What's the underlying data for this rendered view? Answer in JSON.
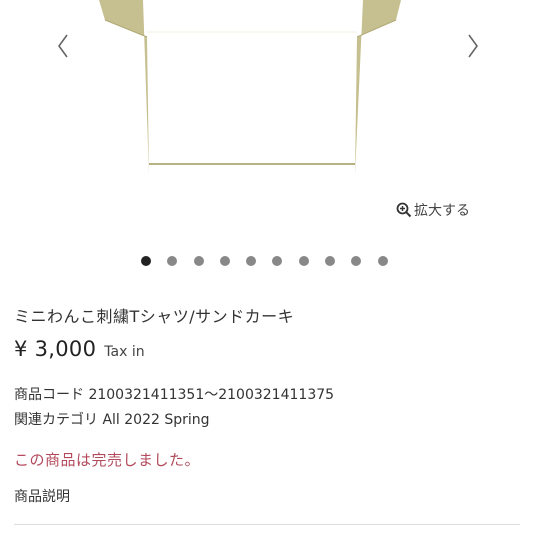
{
  "gallery": {
    "image_alt": "product-photo",
    "prev_icon": "chevron-left-icon",
    "next_icon": "chevron-right-icon",
    "zoom_label": "拡大する",
    "zoom_icon": "zoom-in-icon",
    "slide_count": 10,
    "active_slide": 1
  },
  "product": {
    "title": "ミニわんこ刺繍Tシャツ/サンドカーキ",
    "price": "¥ 3,000",
    "tax_label": "Tax in",
    "code_line": "商品コード 2100321411351〜2100321411375",
    "category_line": "関連カテゴリ All 2022 Spring",
    "soldout_message": "この商品は完売しました。",
    "description_heading": "商品説明"
  },
  "colors": {
    "shirt": "#c6bf8f",
    "soldout": "#b24a5c"
  }
}
